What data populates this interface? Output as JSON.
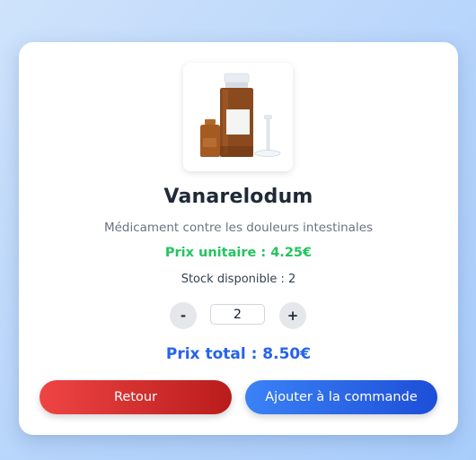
{
  "product": {
    "image_icon": "medicine-bottles-icon",
    "name": "Vanarelodum",
    "description": "Médicament contre les douleurs intestinales",
    "unit_price": "Prix unitaire : 4.25€",
    "stock": "Stock disponible : 2"
  },
  "quantity": {
    "decrement_label": "-",
    "value": "2",
    "increment_label": "+"
  },
  "total": "Prix total : 8.50€",
  "actions": {
    "back_label": "Retour",
    "add_label": "Ajouter à la commande"
  },
  "colors": {
    "unit_price": "#22c55e",
    "total": "#2563eb",
    "back_button": "#dc2626",
    "add_button": "#2563eb"
  }
}
